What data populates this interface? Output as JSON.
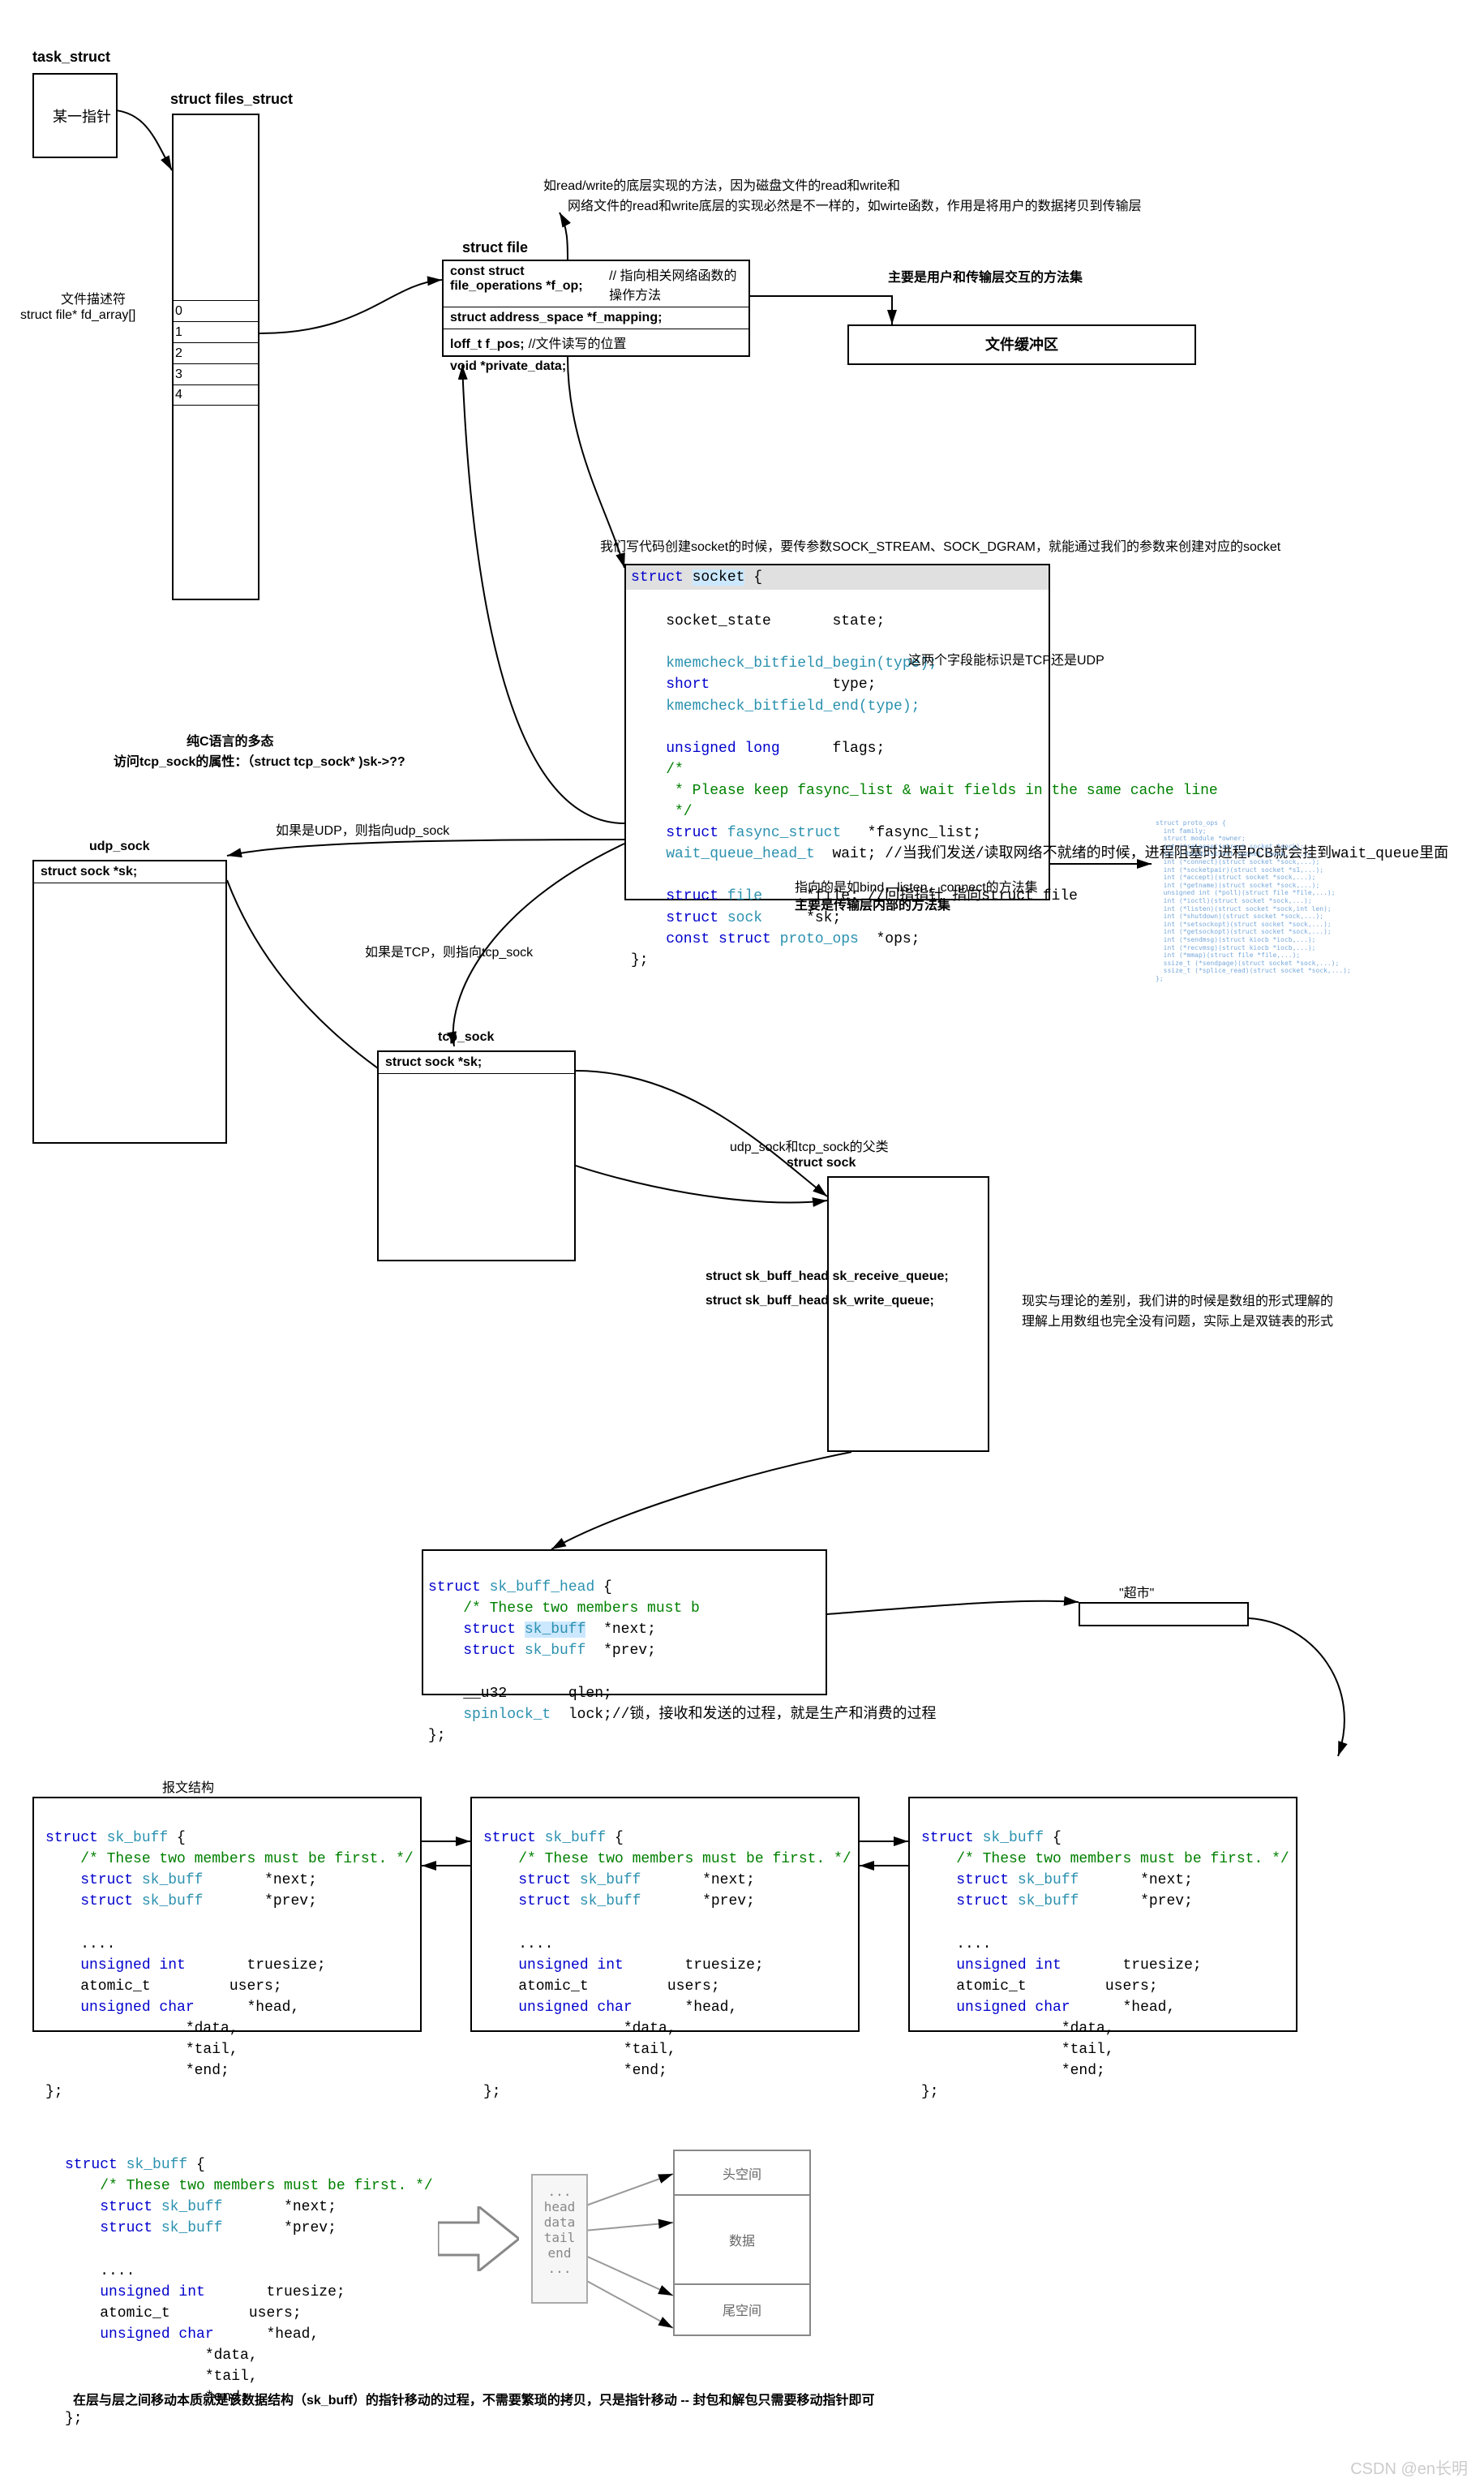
{
  "task_struct": {
    "title": "task_struct",
    "inner": "某一指针"
  },
  "files_struct": {
    "title": "struct files_struct",
    "desc": "文件描述符",
    "fd_array": "struct file* fd_array[]",
    "rows": [
      "0",
      "1",
      "2",
      "3",
      "4"
    ]
  },
  "read_write_note_1": "如read/write的底层实现的方法，因为磁盘文件的read和write和",
  "read_write_note_2": "网络文件的read和write底层的实现必然是不一样的，如wirte函数，作用是将用户的数据拷贝到传输层",
  "struct_file": {
    "title": "struct file",
    "f_op": "const struct file_operations *f_op;",
    "f_op_note": "// 指向相关网络函数的操作方法",
    "f_op_side": "主要是用户和传输层交互的方法集",
    "f_mapping": "struct address_space *f_mapping;",
    "f_pos": "loff_t f_pos;",
    "f_pos_note": "//文件读写的位置",
    "private_data": "void *private_data;",
    "buffer_box": "文件缓冲区"
  },
  "socket_create_note": "我们写代码创建socket的时候，要传参数SOCK_STREAM、SOCK_DGRAM，就能通过我们的参数来创建对应的socket",
  "struct_socket": {
    "header": "struct socket {",
    "state_line": "    socket_state       state;",
    "bitfield_begin": "    kmemcheck_bitfield_begin(type);",
    "type_line": "    short              type;",
    "bitfield_end": "    kmemcheck_bitfield_end(type);",
    "flags_line": "    unsigned long      flags;",
    "comment1": "    /*",
    "comment2": "     * Please keep fasync_list & wait fields in the same cache line",
    "comment3": "     */",
    "fasync_line": "    struct fasync_struct   *fasync_list;",
    "wait_line": "    wait_queue_head_t  wait;",
    "wait_note": " //当我们发送/读取网络不就绪的时候，进程阻塞时进程PCB就会挂到wait_queue里面",
    "file_line": "    struct file     *file;",
    "file_note": " //回指指针 指向struct file",
    "sk_line": "    struct sock     *sk;",
    "ops_line": "    const struct proto_ops  *ops;",
    "close": "};",
    "ops_note1": "指向的是如bind，listen，connect的方法集",
    "ops_note2": "主要是传输层内部的方法集",
    "type_note": "这两个字段能标识是TCP还是UDP"
  },
  "polymorphism": {
    "line1": "纯C语言的多态",
    "line2": "访问tcp_sock的属性：（struct tcp_sock* )sk->??"
  },
  "udp_sock": {
    "title": "udp_sock",
    "sk": "struct sock *sk;",
    "note_udp": "如果是UDP，则指向udp_sock",
    "note_tcp": "如果是TCP，则指向tcp_sock"
  },
  "tcp_sock": {
    "title": "tcp_sock",
    "sk": "struct sock *sk;"
  },
  "struct_sock": {
    "parent": "udp_sock和tcp_sock的父类",
    "title": "struct sock",
    "receive": "struct sk_buff_head  sk_receive_queue;",
    "write": "struct sk_buff_head  sk_write_queue;",
    "note_right1": "现实与理论的差别，我们讲的时候是数组的形式理解的",
    "note_right2": "理解上用数组也完全没有问题，实际上是双链表的形式"
  },
  "sk_buff_head": {
    "line1": "struct sk_buff_head {",
    "line2": "    /* These two members must b",
    "line3": "    struct sk_buff  *next;",
    "line4": "    struct sk_buff  *prev;",
    "line5": "",
    "line6": "    __u32       qlen;",
    "line7": "    spinlock_t  lock;",
    "line7_note": "//锁，接收和发送的过程，就是生产和消费的过程",
    "line8": "};"
  },
  "supermarket": "\"超市\"",
  "packet_struct_label": "报文结构",
  "sk_buff_common": {
    "l1": "struct sk_buff {",
    "l2": "    /* These two members must be first. */",
    "l3": "    struct sk_buff       *next;",
    "l4": "    struct sk_buff       *prev;",
    "l5": "",
    "l6": "    ....",
    "l7": "    unsigned int       truesize;",
    "l8": "    atomic_t         users;",
    "l9": "    unsigned char      *head,",
    "l10": "                *data,",
    "l11": "                *tail,",
    "l12": "                *end;",
    "l13": "};"
  },
  "mem_diagram": {
    "headspace": "头空间",
    "data": "数据",
    "tailspace": "尾空间",
    "ptrs": "...\nhead\ndata\ntail\nend\n..."
  },
  "bottom_note": "在层与层之间移动本质就是该数据结构（sk_buff）的指针移动的过程，不需要繁琐的拷贝，只是指针移动     -- 封包和解包只需要移动指针即可",
  "watermark": "CSDN @en长明",
  "blurry_code": "struct proto_ops {\n  int family;\n  struct module *owner;\n  int (*release)(struct socket *sock);\n  int (*bind)(struct socket *sock, ...);\n  int (*connect)(struct socket *sock,...);\n  int (*socketpair)(struct socket *s1,...);\n  int (*accept)(struct socket *sock,...);\n  int (*getname)(struct socket *sock,...);\n  unsigned int (*poll)(struct file *file,...);\n  int (*ioctl)(struct socket *sock,...);\n  int (*listen)(struct socket *sock,int len);\n  int (*shutdown)(struct socket *sock,...);\n  int (*setsockopt)(struct socket *sock,...);\n  int (*getsockopt)(struct socket *sock,...);\n  int (*sendmsg)(struct kiocb *iocb,...);\n  int (*recvmsg)(struct kiocb *iocb,...);\n  int (*mmap)(struct file *file,...);\n  ssize_t (*sendpage)(struct socket *sock,...);\n  ssize_t (*splice_read)(struct socket *sock,...);\n};"
}
